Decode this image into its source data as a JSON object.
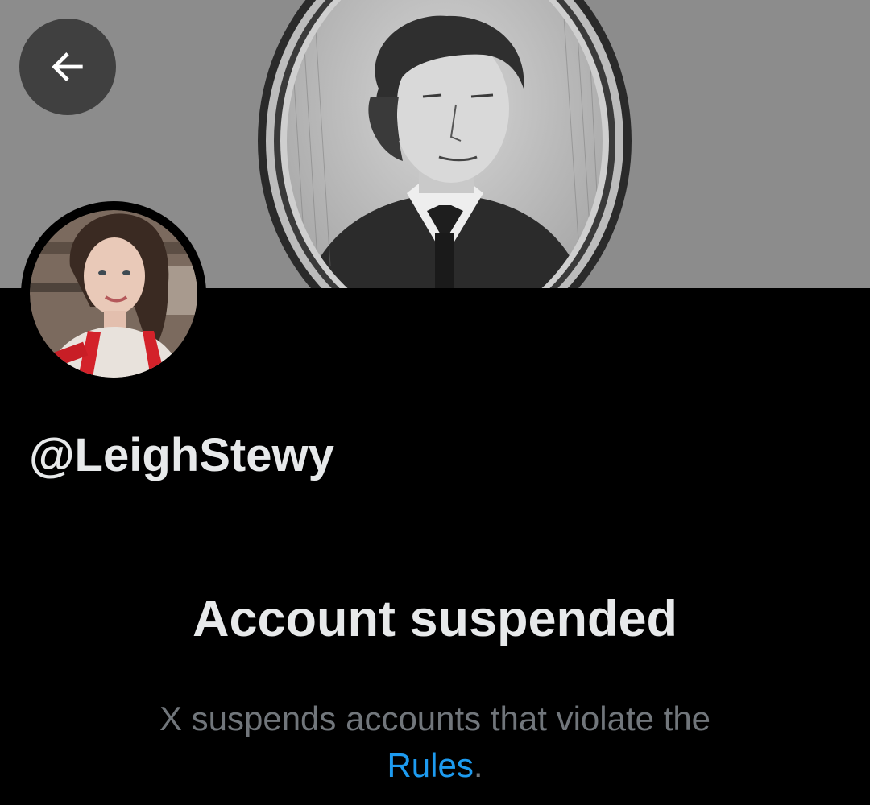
{
  "header": {
    "back_icon": "arrow-left-icon",
    "back_button_label": "Back"
  },
  "profile": {
    "handle": "@LeighStewy",
    "banner_image": "engraved-portrait-in-oval-frame",
    "avatar_image": "woman-profile-photo"
  },
  "suspension": {
    "title": "Account suspended",
    "message_before_link": "X suspends accounts that violate the",
    "link_text": "Rules",
    "message_after_link": "."
  },
  "colors": {
    "background": "#000000",
    "primary_text": "#e7e9ea",
    "secondary_text": "#71767b",
    "link": "#1d9bf0",
    "banner": "#8a8a8a"
  }
}
